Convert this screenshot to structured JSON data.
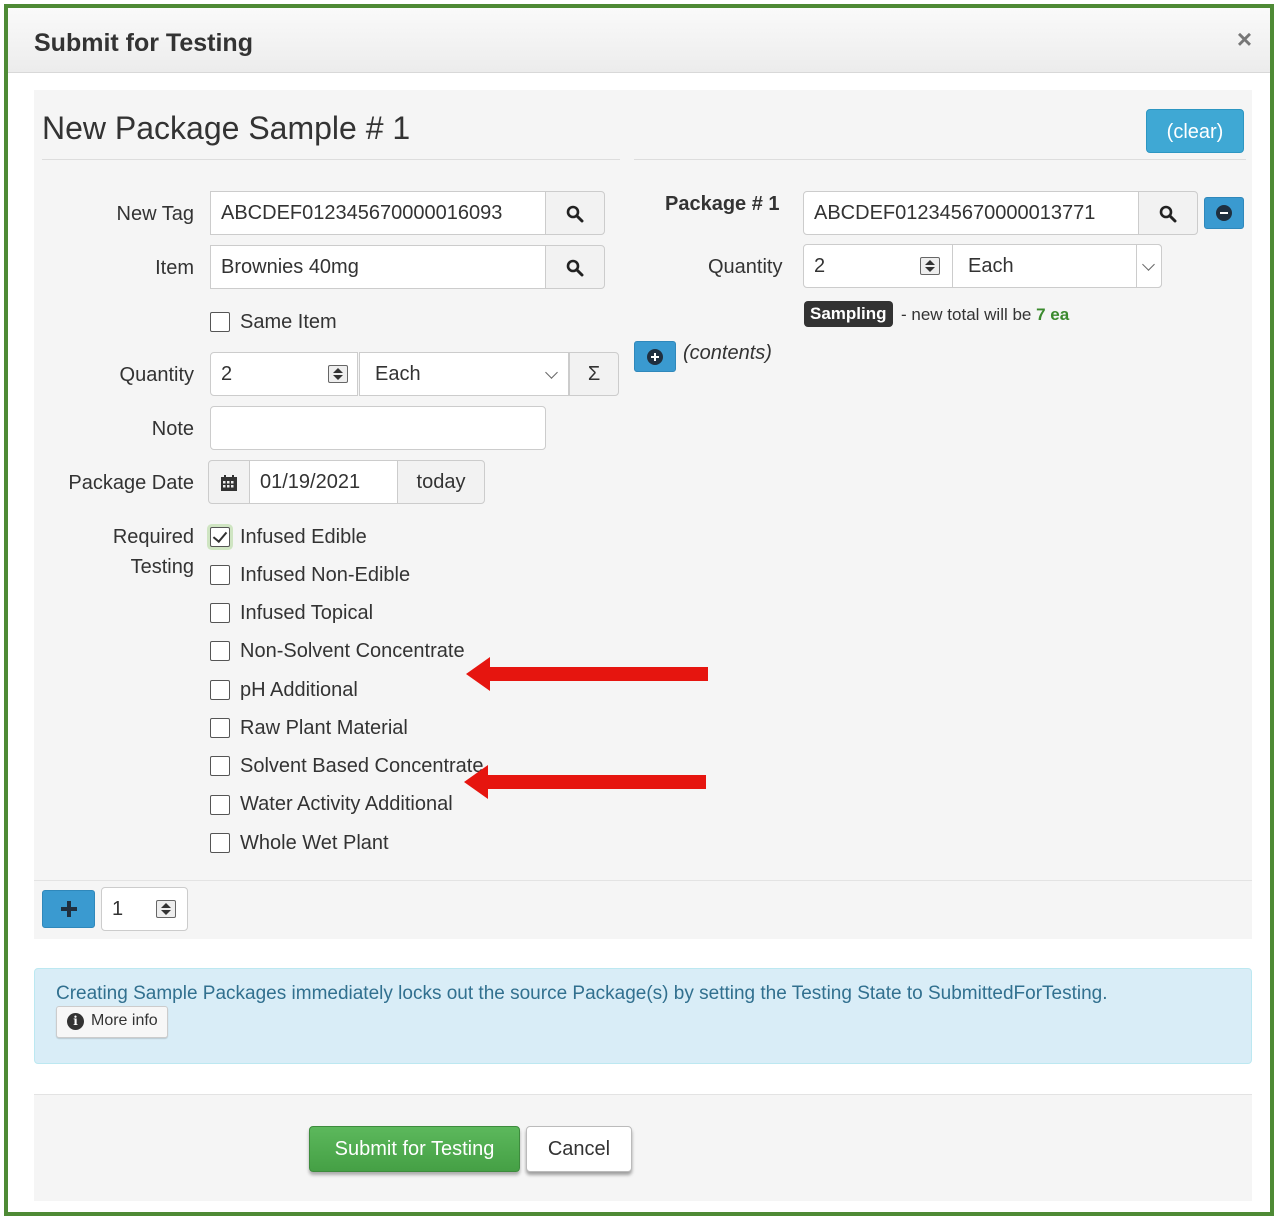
{
  "dialog": {
    "title": "Submit for Testing",
    "close": "×"
  },
  "sample": {
    "heading": "New Package Sample # 1",
    "clear_label": "(clear)",
    "new_tag_label": "New Tag",
    "new_tag_value": "ABCDEF012345670000016093",
    "item_label": "Item",
    "item_value": "Brownies 40mg",
    "same_item_label": "Same Item",
    "quantity_label": "Quantity",
    "quantity_value": "2",
    "unit_value": "Each",
    "sum_symbol": "Σ",
    "note_label": "Note",
    "note_value": "",
    "package_date_label": "Package Date",
    "package_date_value": "01/19/2021",
    "today_label": "today",
    "required_testing_label_1": "Required",
    "required_testing_label_2": "Testing",
    "tests": [
      {
        "label": "Infused Edible",
        "checked": true
      },
      {
        "label": "Infused Non-Edible",
        "checked": false
      },
      {
        "label": "Infused Topical",
        "checked": false
      },
      {
        "label": "Non-Solvent Concentrate",
        "checked": false
      },
      {
        "label": "pH Additional",
        "checked": false
      },
      {
        "label": "Raw Plant Material",
        "checked": false
      },
      {
        "label": "Solvent Based Concentrate",
        "checked": false
      },
      {
        "label": "Water Activity Additional",
        "checked": false
      },
      {
        "label": "Whole Wet Plant",
        "checked": false
      }
    ]
  },
  "package": {
    "label": "Package # 1",
    "tag_value": "ABCDEF012345670000013771",
    "quantity_label": "Quantity",
    "quantity_value": "2",
    "unit_value": "Each",
    "badge": "Sampling",
    "total_prefix": "- new total will be ",
    "total_value": "7 ea",
    "contents_label": "(contents)"
  },
  "add_row": {
    "count_value": "1"
  },
  "alert": {
    "message": "Creating Sample Packages immediately locks out the source Package(s) by setting the Testing State to SubmittedForTesting.",
    "more_info": "More info"
  },
  "footer": {
    "submit_label": "Submit for Testing",
    "cancel_label": "Cancel"
  },
  "colors": {
    "frame": "#4e8a35",
    "accent_blue": "#3fa8d4",
    "submit_green": "#5cb85c",
    "arrow_red": "#e6150f"
  },
  "icons": [
    "close-icon",
    "search-icon",
    "minus-circle-icon",
    "plus-circle-icon",
    "calendar-icon",
    "plus-icon",
    "info-icon",
    "arrow-left-icon"
  ]
}
